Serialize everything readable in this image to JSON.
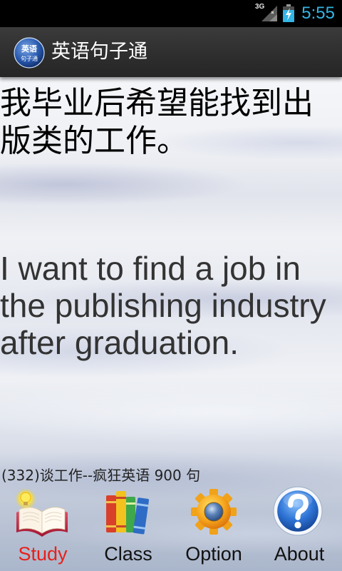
{
  "status_bar": {
    "network_type": "3G",
    "time": "5:55",
    "icons": {
      "signal": "signal-strength-icon",
      "battery": "battery-charging-icon"
    }
  },
  "title_bar": {
    "app_icon": "app-logo-icon",
    "logo_text_top": "英语",
    "logo_text_bottom": "句子通",
    "title": "英语句子通"
  },
  "sentence": {
    "chinese": "我毕业后希望能找到出版类的工作。",
    "english": "I want to find a job in the publishing industry after graduation."
  },
  "footer": {
    "caption": "(332)谈工作--疯狂英语 900 句"
  },
  "bottom_nav": {
    "items": [
      {
        "label": "Study",
        "icon": "open-book-lightbulb-icon",
        "active": true
      },
      {
        "label": "Class",
        "icon": "book-stack-icon",
        "active": false
      },
      {
        "label": "Option",
        "icon": "gear-icon",
        "active": false
      },
      {
        "label": "About",
        "icon": "help-question-icon",
        "active": false
      }
    ]
  },
  "colors": {
    "status_time": "#33b5e5",
    "active_nav_label": "#e8201a",
    "nav_label": "#111111",
    "chinese_text": "#000000",
    "english_text": "#333333"
  }
}
